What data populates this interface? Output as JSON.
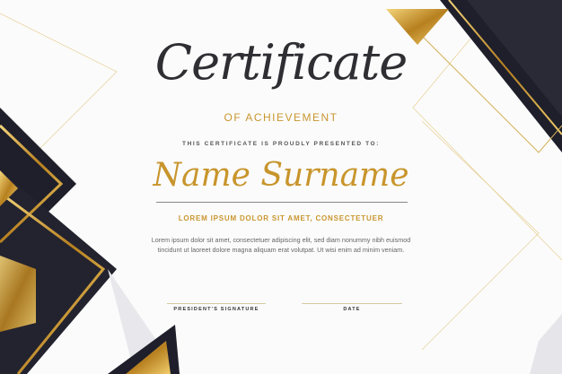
{
  "certificate": {
    "title": "Certificate",
    "subtitle": "OF ACHIEVEMENT",
    "presented_to": "THIS CERTIFICATE IS PROUDLY PRESENTED TO:",
    "recipient_name": "Name Surname",
    "headline": "LOREM IPSUM DOLOR SIT AMET, CONSECTETUER",
    "body": "Lorem ipsum dolor sit amet, consectetuer adipiscing elit, sed diam nonummy nibh euismod tincidunt ut laoreet dolore magna aliquam erat volutpat. Ut wisi enim ad minim veniam.",
    "signature_label": "PRESIDENT'S SIGNATURE",
    "date_label": "DATE"
  },
  "colors": {
    "gold": "#c8952c",
    "dark": "#1f1f2b",
    "background": "#fbfbfb"
  }
}
